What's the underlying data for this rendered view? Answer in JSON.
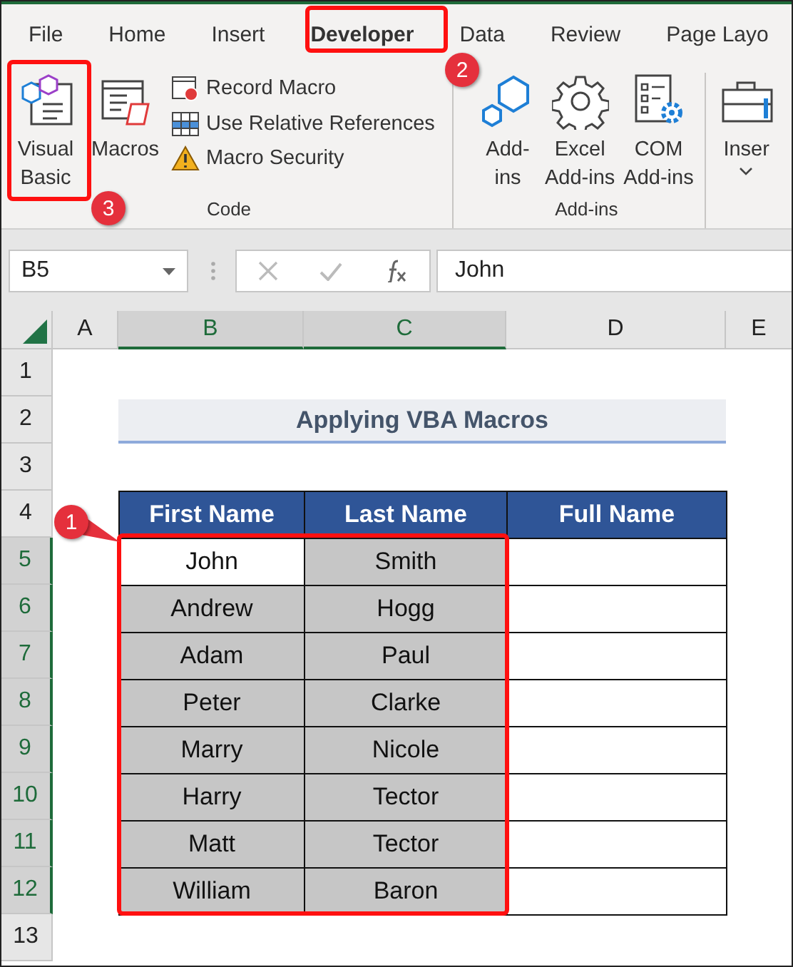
{
  "tabs": [
    {
      "label": "File",
      "selected": false
    },
    {
      "label": "Home",
      "selected": false
    },
    {
      "label": "Insert",
      "selected": false
    },
    {
      "label": "Developer",
      "selected": true
    },
    {
      "label": "Data",
      "selected": false
    },
    {
      "label": "Review",
      "selected": false
    },
    {
      "label": "Page Layo",
      "selected": false
    }
  ],
  "ribbon_groups": [
    {
      "label": "Code",
      "items": [
        {
          "kind": "large",
          "label": "Visual\nBasic"
        },
        {
          "kind": "large",
          "label": "Macros"
        },
        {
          "kind": "small",
          "label": "Record Macro"
        },
        {
          "kind": "small",
          "label": "Use Relative References"
        },
        {
          "kind": "small",
          "label": "Macro Security"
        }
      ]
    },
    {
      "label": "Add-ins",
      "items": [
        {
          "kind": "large",
          "label": "Add-\nins"
        },
        {
          "kind": "large",
          "label": "Excel\nAdd-ins"
        },
        {
          "kind": "large",
          "label": "COM\nAdd-ins"
        }
      ]
    },
    {
      "items": [
        {
          "kind": "dropdown",
          "label": "Inser"
        }
      ]
    }
  ],
  "name_box": "B5",
  "formula": "John",
  "column_headers": [
    {
      "label": "A",
      "selected": false
    },
    {
      "label": "B",
      "selected": true
    },
    {
      "label": "C",
      "selected": true
    },
    {
      "label": "D",
      "selected": false
    },
    {
      "label": "E",
      "selected": false
    }
  ],
  "row_headers": [
    {
      "label": "1",
      "selected": false
    },
    {
      "label": "2",
      "selected": false
    },
    {
      "label": "3",
      "selected": false
    },
    {
      "label": "4",
      "selected": false
    },
    {
      "label": "5",
      "selected": true
    },
    {
      "label": "6",
      "selected": true
    },
    {
      "label": "7",
      "selected": true
    },
    {
      "label": "8",
      "selected": true
    },
    {
      "label": "9",
      "selected": true
    },
    {
      "label": "10",
      "selected": true
    },
    {
      "label": "11",
      "selected": true
    },
    {
      "label": "12",
      "selected": true
    },
    {
      "label": "13",
      "selected": false
    }
  ],
  "table": {
    "title": "Applying VBA Macros",
    "columns": [
      "First Name",
      "Last Name",
      "Full Name"
    ],
    "rows": [
      {
        "cells": [
          {
            "text": "John",
            "selected": false
          },
          {
            "text": "Smith",
            "selected": true
          }
        ]
      },
      {
        "cells": [
          {
            "text": "Andrew",
            "selected": true
          },
          {
            "text": "Hogg",
            "selected": true
          }
        ]
      },
      {
        "cells": [
          {
            "text": "Adam",
            "selected": true
          },
          {
            "text": "Paul",
            "selected": true
          }
        ]
      },
      {
        "cells": [
          {
            "text": "Peter",
            "selected": true
          },
          {
            "text": "Clarke",
            "selected": true
          }
        ]
      },
      {
        "cells": [
          {
            "text": "Marry",
            "selected": true
          },
          {
            "text": "Nicole",
            "selected": true
          }
        ]
      },
      {
        "cells": [
          {
            "text": "Harry",
            "selected": true
          },
          {
            "text": "Tector",
            "selected": true
          }
        ]
      },
      {
        "cells": [
          {
            "text": "Matt",
            "selected": true
          },
          {
            "text": "Tector",
            "selected": true
          }
        ]
      },
      {
        "cells": [
          {
            "text": "William",
            "selected": true
          },
          {
            "text": "Baron",
            "selected": true
          }
        ]
      }
    ]
  },
  "annotations": [
    {
      "label": "1"
    },
    {
      "label": "2"
    },
    {
      "label": "3"
    }
  ]
}
